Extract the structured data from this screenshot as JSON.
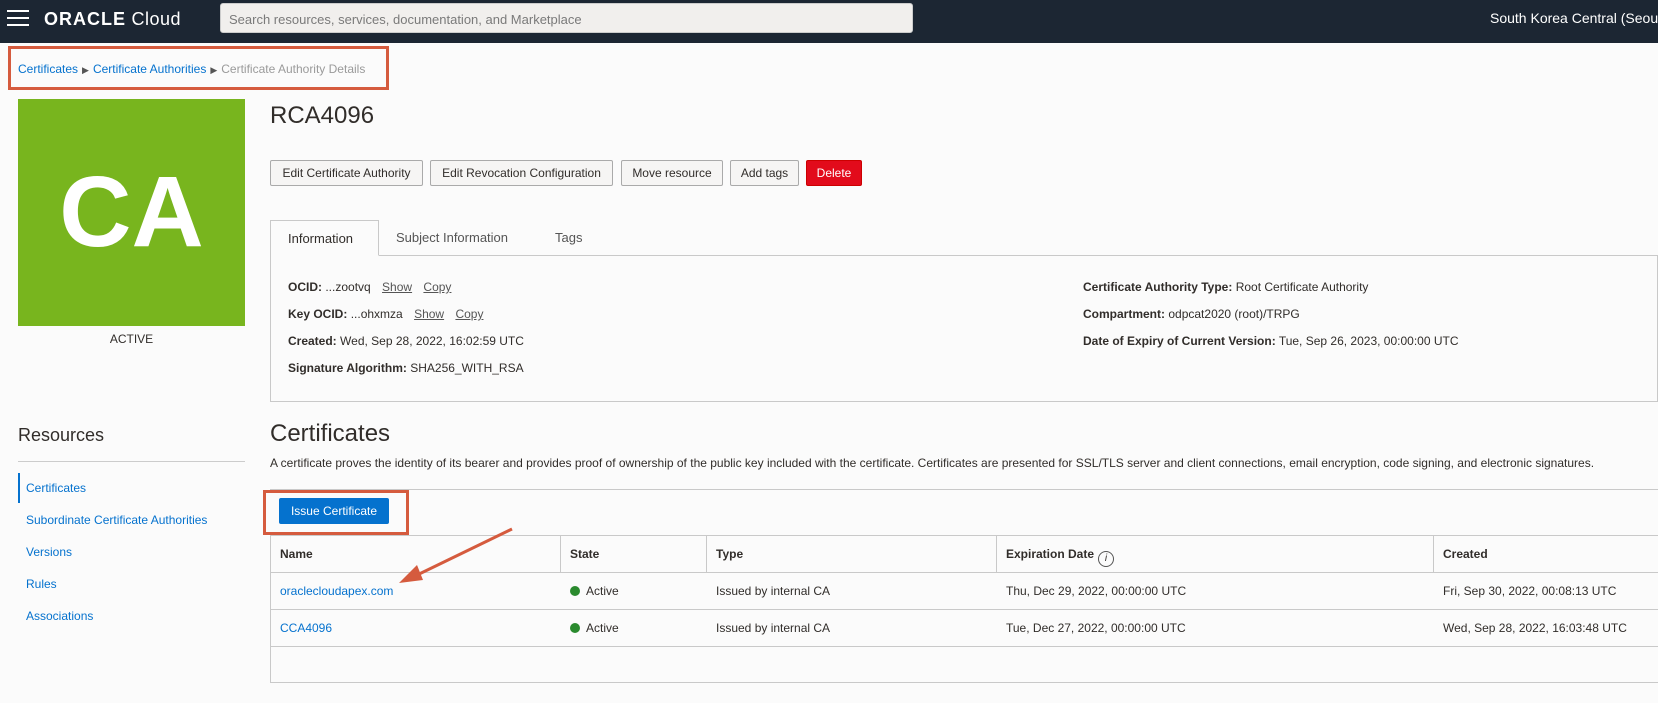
{
  "header": {
    "logo_brand": "ORACLE",
    "logo_product": "Cloud",
    "search_placeholder": "Search resources, services, documentation, and Marketplace",
    "region": "South Korea Central (Seoul)"
  },
  "breadcrumb": {
    "items": [
      "Certificates",
      "Certificate Authorities"
    ],
    "current": "Certificate Authority Details"
  },
  "ca_tile": {
    "label": "CA",
    "status": "ACTIVE",
    "color": "#78b51e"
  },
  "resources": {
    "title": "Resources",
    "items": [
      "Certificates",
      "Subordinate Certificate Authorities",
      "Versions",
      "Rules",
      "Associations"
    ]
  },
  "page": {
    "title": "RCA4096",
    "actions": [
      "Edit Certificate Authority",
      "Edit Revocation Configuration",
      "Move resource",
      "Add tags",
      "Delete"
    ]
  },
  "tabs": [
    "Information",
    "Subject Information",
    "Tags"
  ],
  "info": {
    "ocid_label": "OCID:",
    "ocid_value": "...zootvq",
    "key_ocid_label": "Key OCID:",
    "key_ocid_value": "...ohxmza",
    "show": "Show",
    "copy": "Copy",
    "created_label": "Created:",
    "created_value": "Wed, Sep 28, 2022, 16:02:59 UTC",
    "sig_label": "Signature Algorithm:",
    "sig_value": "SHA256_WITH_RSA",
    "ca_type_label": "Certificate Authority Type:",
    "ca_type_value": "Root Certificate Authority",
    "compartment_label": "Compartment:",
    "compartment_value": "odpcat2020 (root)/TRPG",
    "expiry_label": "Date of Expiry of Current Version:",
    "expiry_value": "Tue, Sep 26, 2023, 00:00:00 UTC"
  },
  "certificates": {
    "title": "Certificates",
    "description": "A certificate proves the identity of its bearer and provides proof of ownership of the public key included with the certificate. Certificates are presented for SSL/TLS server and client connections, email encryption, code signing, and electronic signatures.",
    "issue_button": "Issue Certificate",
    "columns": [
      "Name",
      "State",
      "Type",
      "Expiration Date",
      "Created"
    ],
    "rows": [
      {
        "name": "oraclecloudapex.com",
        "state": "Active",
        "type": "Issued by internal CA",
        "expiration": "Thu, Dec 29, 2022, 00:00:00 UTC",
        "created": "Fri, Sep 30, 2022, 00:08:13 UTC"
      },
      {
        "name": "CCA4096",
        "state": "Active",
        "type": "Issued by internal CA",
        "expiration": "Tue, Dec 27, 2022, 00:00:00 UTC",
        "created": "Wed, Sep 28, 2022, 16:03:48 UTC"
      }
    ]
  },
  "colors": {
    "accent": "#0572ce",
    "highlight": "#d55b3e",
    "danger": "#e20b1b",
    "active_state": "#2a8a2e"
  }
}
